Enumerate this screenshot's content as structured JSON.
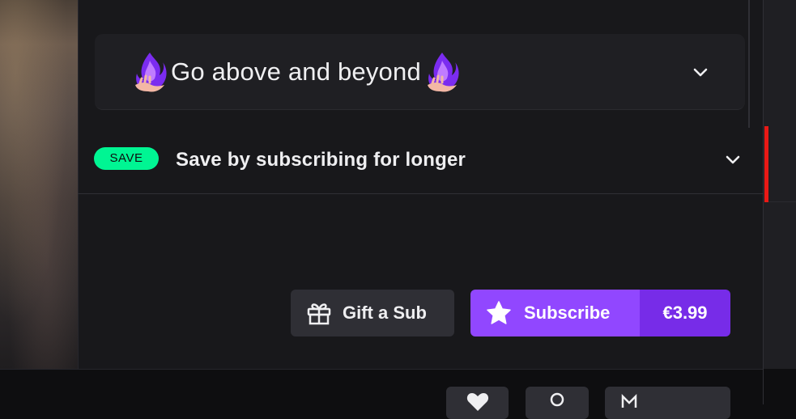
{
  "tier": {
    "title": "Go above and beyond",
    "left_icon": "purple-flame-hand-emote",
    "right_icon": "purple-flame-hand-emote",
    "expand_icon": "chevron-down-icon"
  },
  "save_section": {
    "badge": "SAVE",
    "text": "Save by subscribing for longer",
    "expand_icon": "chevron-down-icon"
  },
  "actions": {
    "gift": {
      "label": "Gift a Sub",
      "icon": "gift-icon"
    },
    "subscribe": {
      "label": "Subscribe",
      "price": "€3.99",
      "icon": "star-icon"
    }
  },
  "bottom_actions": [
    {
      "icon": "heart-icon"
    },
    {
      "icon": "notification-icon"
    },
    {
      "icon": "more-icon"
    }
  ],
  "colors": {
    "accent": "#9147ff",
    "accent_dark": "#772ce8",
    "save_green": "#00f593",
    "live_red": "#e91916",
    "panel_bg": "#18181b",
    "button_bg": "#2f2f35"
  }
}
